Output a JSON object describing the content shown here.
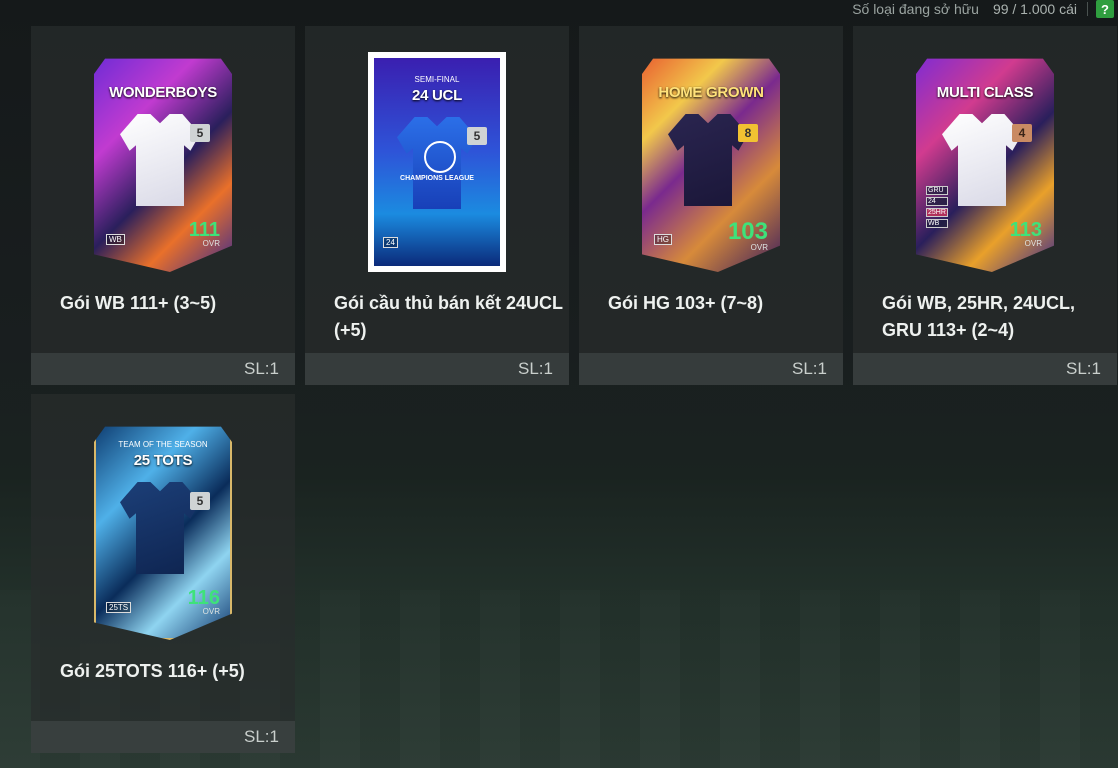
{
  "topbar": {
    "owned_label": "Số loại đang sở hữu",
    "owned_count": "99 / 1.000 cái",
    "help_label": "?"
  },
  "packs": [
    {
      "name": "Gói WB 111+ (3~5)",
      "qty": "SL:1",
      "card": {
        "title": "WONDERBOYS",
        "level": "5",
        "ovr": "111",
        "ovr_label": "OVR",
        "badge": "WB"
      }
    },
    {
      "name": "Gói cầu thủ bán kết 24UCL (+5)",
      "qty": "SL:1",
      "card": {
        "subtitle": "SEMI-FINAL",
        "title": "24 UCL",
        "level": "5",
        "logo_text": "CHAMPIONS LEAGUE",
        "badge": "24"
      }
    },
    {
      "name": "Gói HG 103+ (7~8)",
      "qty": "SL:1",
      "card": {
        "title": "HOME GROWN",
        "level": "8",
        "ovr": "103",
        "ovr_label": "OVR",
        "badge": "HG"
      }
    },
    {
      "name": "Gói WB, 25HR, 24UCL, GRU 113+ (2~4)",
      "qty": "SL:1",
      "card": {
        "title": "MULTI CLASS",
        "level": "4",
        "ovr": "113",
        "ovr_label": "OVR",
        "badges": [
          "GRU",
          "24",
          "25HR",
          "WB"
        ]
      }
    },
    {
      "name": "Gói 25TOTS 116+ (+5)",
      "qty": "SL:1",
      "card": {
        "subtitle": "TEAM OF THE SEASON",
        "title": "25 TOTS",
        "level": "5",
        "ovr": "116",
        "ovr_label": "OVR",
        "badge": "25TS"
      }
    }
  ],
  "colors": {
    "ovr_green": "#3ee27a",
    "help_green": "#2f9e3f",
    "tile_bg": "#282c2d"
  }
}
